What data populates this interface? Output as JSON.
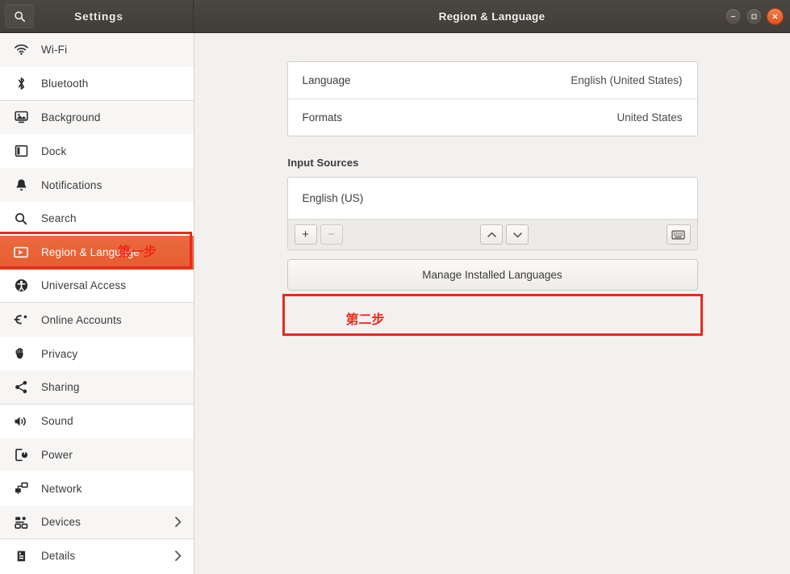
{
  "window": {
    "app_title": "Settings",
    "page_title": "Region & Language",
    "search_icon": "search-icon",
    "controls": {
      "minimize": "minimize-icon",
      "maximize": "maximize-icon",
      "close": "close-icon"
    }
  },
  "colors": {
    "accent_orange": "#e8643a",
    "annotation_red": "#e8291c",
    "titlebar": "#45413c",
    "content_bg": "#f2f1f0"
  },
  "sidebar": {
    "items": [
      {
        "label": "Wi-Fi",
        "icon": "wifi-icon",
        "selected": false,
        "chevron": false
      },
      {
        "label": "Bluetooth",
        "icon": "bluetooth-icon",
        "selected": false,
        "chevron": false
      },
      {
        "label": "Background",
        "icon": "background-icon",
        "selected": false,
        "chevron": false
      },
      {
        "label": "Dock",
        "icon": "dock-icon",
        "selected": false,
        "chevron": false
      },
      {
        "label": "Notifications",
        "icon": "bell-icon",
        "selected": false,
        "chevron": false
      },
      {
        "label": "Search",
        "icon": "search-icon",
        "selected": false,
        "chevron": false
      },
      {
        "label": "Region & Language",
        "icon": "region-language-icon",
        "selected": true,
        "chevron": false
      },
      {
        "label": "Universal Access",
        "icon": "accessibility-icon",
        "selected": false,
        "chevron": false
      },
      {
        "label": "Online Accounts",
        "icon": "online-accounts-icon",
        "selected": false,
        "chevron": false
      },
      {
        "label": "Privacy",
        "icon": "privacy-hand-icon",
        "selected": false,
        "chevron": false
      },
      {
        "label": "Sharing",
        "icon": "share-icon",
        "selected": false,
        "chevron": false
      },
      {
        "label": "Sound",
        "icon": "sound-icon",
        "selected": false,
        "chevron": false
      },
      {
        "label": "Power",
        "icon": "power-icon",
        "selected": false,
        "chevron": false
      },
      {
        "label": "Network",
        "icon": "network-icon",
        "selected": false,
        "chevron": false
      },
      {
        "label": "Devices",
        "icon": "devices-icon",
        "selected": false,
        "chevron": true
      },
      {
        "label": "Details",
        "icon": "details-icon",
        "selected": false,
        "chevron": true
      }
    ]
  },
  "main": {
    "language_row": {
      "label": "Language",
      "value": "English (United States)"
    },
    "formats_row": {
      "label": "Formats",
      "value": "United States"
    },
    "input_sources": {
      "section_title": "Input Sources",
      "entries": [
        "English (US)"
      ],
      "toolbar": {
        "add_label": "+",
        "remove_label": "−",
        "move_up_icon": "chevron-up-icon",
        "move_down_icon": "chevron-down-icon",
        "keyboard_icon": "keyboard-icon"
      }
    },
    "manage_button": {
      "label": "Manage Installed Languages"
    }
  },
  "annotations": {
    "step1": "第一步",
    "step2": "第二步"
  }
}
